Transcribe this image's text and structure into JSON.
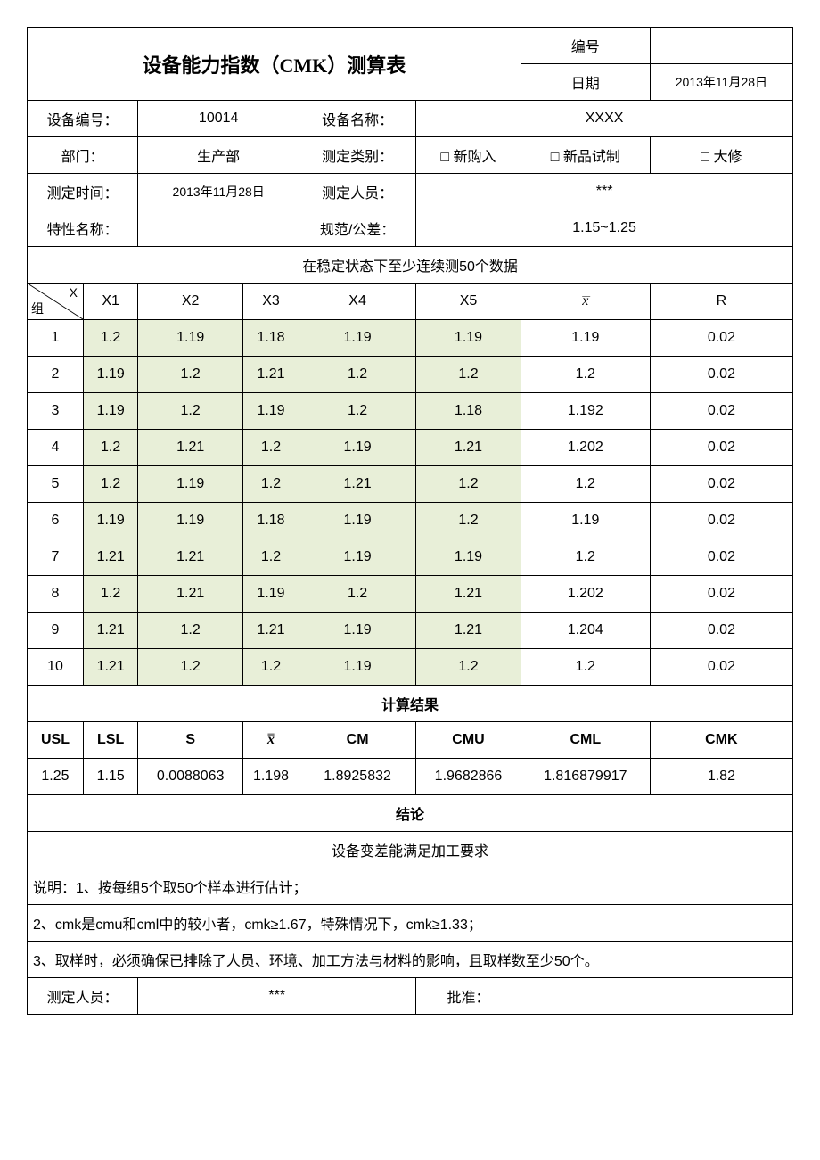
{
  "title": "设备能力指数（CMK）测算表",
  "header": {
    "serial_label": "编号",
    "serial_value": "",
    "date_label": "日期",
    "date_value": "2013年11月28日"
  },
  "info": {
    "device_no_label": "设备编号：",
    "device_no": "10014",
    "device_name_label": "设备名称：",
    "device_name": "XXXX",
    "dept_label": "部门：",
    "dept": "生产部",
    "meas_type_label": "测定类别：",
    "opt_new": "□ 新购入",
    "opt_trial": "□ 新品试制",
    "opt_repair": "□ 大修",
    "meas_time_label": "测定时间：",
    "meas_time": "2013年11月28日",
    "meas_person_label": "测定人员：",
    "meas_person": "***",
    "char_name_label": "特性名称：",
    "char_name": "",
    "spec_label": "规范/公差：",
    "spec": "1.15~1.25"
  },
  "data_banner": "在稳定状态下至少连续测50个数据",
  "columns": {
    "diag_top": "X",
    "diag_bottom": "组",
    "X1": "X1",
    "X2": "X2",
    "X3": "X3",
    "X4": "X4",
    "X5": "X5",
    "xbar": "x",
    "R": "R"
  },
  "chart_data": {
    "type": "table",
    "columns": [
      "组",
      "X1",
      "X2",
      "X3",
      "X4",
      "X5",
      "x̄",
      "R"
    ],
    "rows": [
      {
        "g": "1",
        "x1": "1.2",
        "x2": "1.19",
        "x3": "1.18",
        "x4": "1.19",
        "x5": "1.19",
        "xb": "1.19",
        "r": "0.02"
      },
      {
        "g": "2",
        "x1": "1.19",
        "x2": "1.2",
        "x3": "1.21",
        "x4": "1.2",
        "x5": "1.2",
        "xb": "1.2",
        "r": "0.02"
      },
      {
        "g": "3",
        "x1": "1.19",
        "x2": "1.2",
        "x3": "1.19",
        "x4": "1.2",
        "x5": "1.18",
        "xb": "1.192",
        "r": "0.02"
      },
      {
        "g": "4",
        "x1": "1.2",
        "x2": "1.21",
        "x3": "1.2",
        "x4": "1.19",
        "x5": "1.21",
        "xb": "1.202",
        "r": "0.02"
      },
      {
        "g": "5",
        "x1": "1.2",
        "x2": "1.19",
        "x3": "1.2",
        "x4": "1.21",
        "x5": "1.2",
        "xb": "1.2",
        "r": "0.02"
      },
      {
        "g": "6",
        "x1": "1.19",
        "x2": "1.19",
        "x3": "1.18",
        "x4": "1.19",
        "x5": "1.2",
        "xb": "1.19",
        "r": "0.02"
      },
      {
        "g": "7",
        "x1": "1.21",
        "x2": "1.21",
        "x3": "1.2",
        "x4": "1.19",
        "x5": "1.19",
        "xb": "1.2",
        "r": "0.02"
      },
      {
        "g": "8",
        "x1": "1.2",
        "x2": "1.21",
        "x3": "1.19",
        "x4": "1.2",
        "x5": "1.21",
        "xb": "1.202",
        "r": "0.02"
      },
      {
        "g": "9",
        "x1": "1.21",
        "x2": "1.2",
        "x3": "1.21",
        "x4": "1.19",
        "x5": "1.21",
        "xb": "1.204",
        "r": "0.02"
      },
      {
        "g": "10",
        "x1": "1.21",
        "x2": "1.2",
        "x3": "1.2",
        "x4": "1.19",
        "x5": "1.2",
        "xb": "1.2",
        "r": "0.02"
      }
    ]
  },
  "results_banner": "计算结果",
  "results_hdr": {
    "USL": "USL",
    "LSL": "LSL",
    "S": "S",
    "xbb": "x",
    "CM": "CM",
    "CMU": "CMU",
    "CML": "CML",
    "CMK": "CMK"
  },
  "results": {
    "USL": "1.25",
    "LSL": "1.15",
    "S": "0.0088063",
    "xbb": "1.198",
    "CM": "1.8925832",
    "CMU": "1.9682866",
    "CML": "1.816879917",
    "CMK": "1.82"
  },
  "conclusion_banner": "结论",
  "conclusion": "设备变差能满足加工要求",
  "notes": {
    "n1": "说明：1、按每组5个取50个样本进行估计；",
    "n2": "2、cmk是cmu和cml中的较小者，cmk≥1.67，特殊情况下，cmk≥1.33；",
    "n3": "3、取样时，必须确保已排除了人员、环境、加工方法与材料的影响，且取样数至少50个。"
  },
  "footer": {
    "meas_person_label": "测定人员：",
    "meas_person": "***",
    "approve_label": "批准：",
    "approve": ""
  }
}
